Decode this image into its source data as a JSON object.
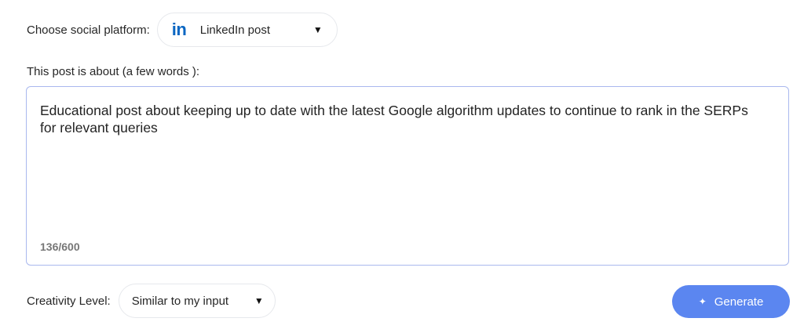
{
  "platform": {
    "label": "Choose social platform:",
    "icon": "linkedin-icon",
    "icon_glyph": "in",
    "selected": "LinkedIn post",
    "brand_color": "#0a66c2"
  },
  "about": {
    "label": "This post is about (a few words ):",
    "value": "Educational post about keeping up to date with the latest Google algorithm updates to continue to rank in the SERPs for relevant queries",
    "counter": "136/600"
  },
  "creativity": {
    "label": "Creativity Level:",
    "selected": "Similar to my input"
  },
  "generate": {
    "label": "Generate",
    "icon": "sparkle-icon",
    "color": "#5b86f0"
  }
}
